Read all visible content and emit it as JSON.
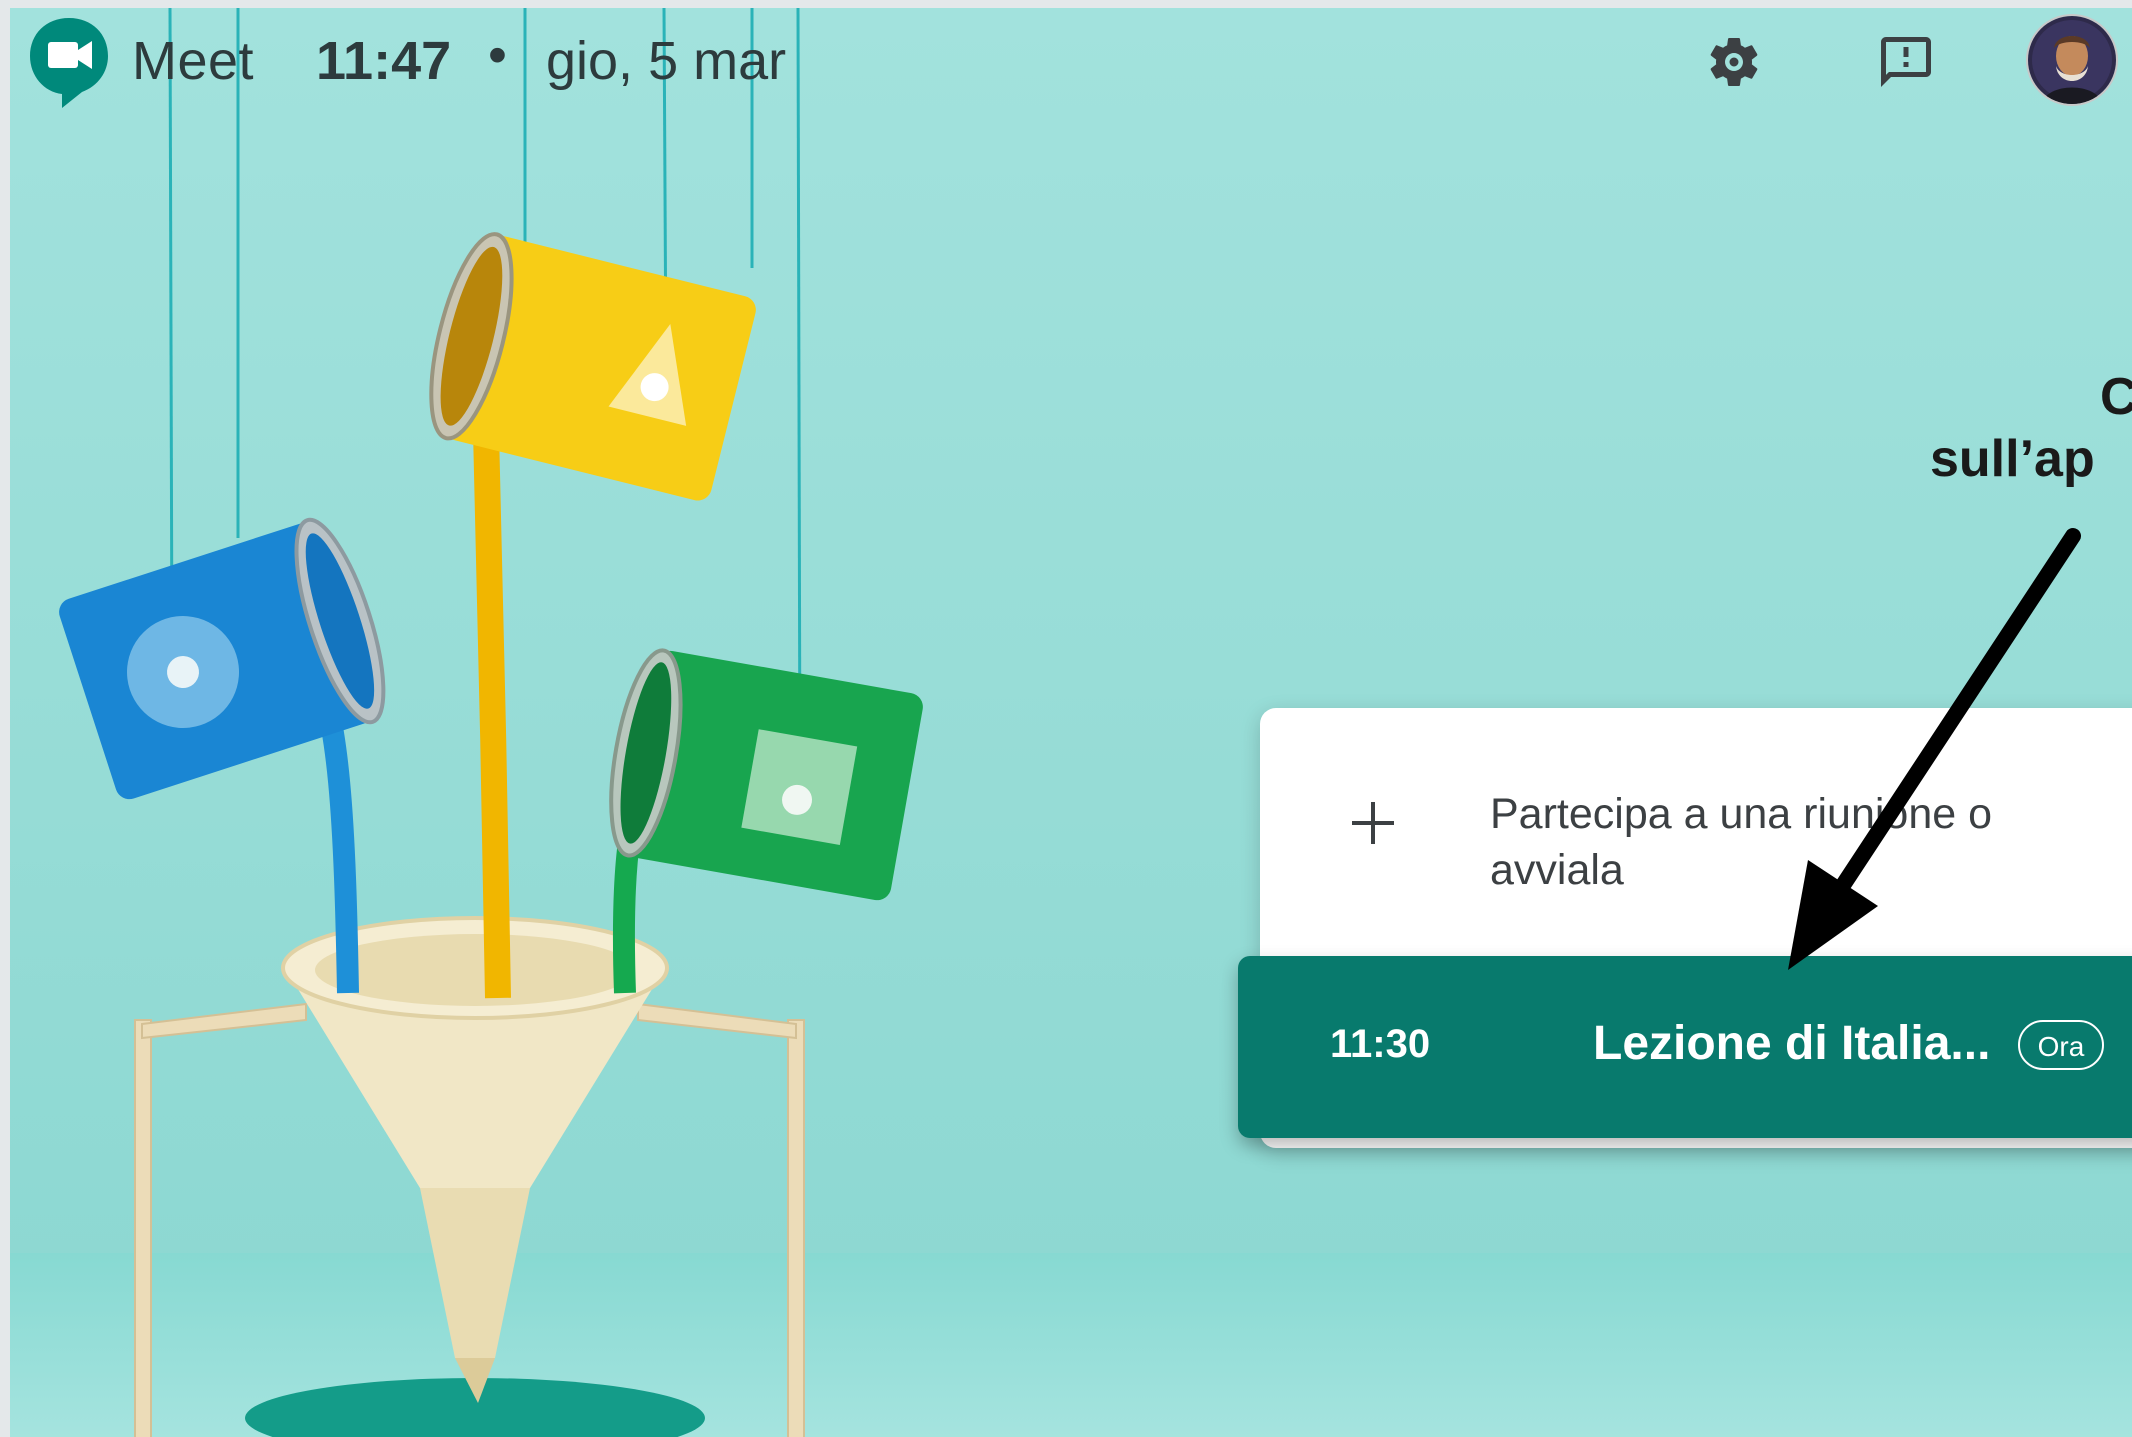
{
  "header": {
    "app_name": "Meet",
    "time": "11:47",
    "separator": "•",
    "date": "gio, 5 mar"
  },
  "icons": {
    "logo": "google-meet-logo",
    "settings": "gear-icon",
    "feedback": "feedback-icon",
    "avatar": "user-avatar",
    "plus": "plus-icon"
  },
  "callout": {
    "line1": "C",
    "line2": "sull’ap"
  },
  "card": {
    "join_text": "Partecipa a una riunione o avviala"
  },
  "meeting": {
    "time": "11:30",
    "title": "Lezione di Italia...",
    "badge": "Ora"
  },
  "colors": {
    "background": "#9ddfd9",
    "meeting_row": "#087a6d",
    "text_dark": "#2d3b3d"
  }
}
